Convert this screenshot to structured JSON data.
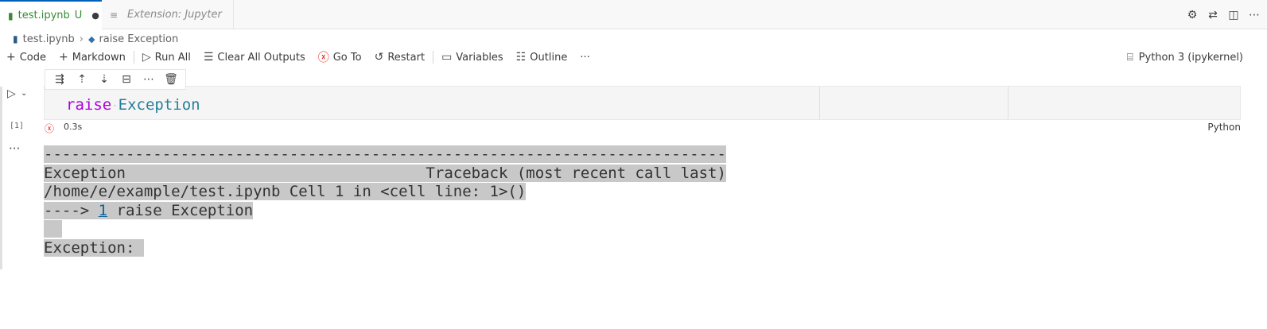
{
  "tabs": [
    {
      "label": "test.ipynb",
      "modified": "U",
      "dirty_dot": "●",
      "active": true
    },
    {
      "label": "Extension: Jupyter",
      "active": false
    }
  ],
  "tab_actions": [
    "gear-icon",
    "compare-icon",
    "split-editor-icon",
    "more-icon"
  ],
  "breadcrumb": {
    "file": "test.ipynb",
    "symbol": "raise Exception"
  },
  "toolbar": {
    "add_code": "Code",
    "add_markdown": "Markdown",
    "run_all": "Run All",
    "clear_outputs": "Clear All Outputs",
    "go_to": "Go To",
    "restart": "Restart",
    "variables": "Variables",
    "outline": "Outline",
    "more": "···",
    "kernel": "Python 3 (ipykernel)"
  },
  "cell": {
    "execution_count": "[1]",
    "code_keyword": "raise",
    "code_class": "Exception",
    "status_time": "0.3s",
    "language": "Python",
    "output_menu": "···"
  },
  "output": {
    "line1": "---------------------------------------------------------------------------",
    "line2": "Exception                                 Traceback (most recent call last)",
    "line3": "/home/e/example/test.ipynb Cell 1 in <cell line: 1>()",
    "line4_prefix": "----> ",
    "line4_link": "1",
    "line4_suffix": " raise Exception",
    "line6": "Exception: "
  },
  "colors": {
    "active_tab_text": "#388a34",
    "error": "#e51400",
    "keyword": "#af00db",
    "class": "#267f99",
    "output_highlight": "#c8c8c8"
  }
}
